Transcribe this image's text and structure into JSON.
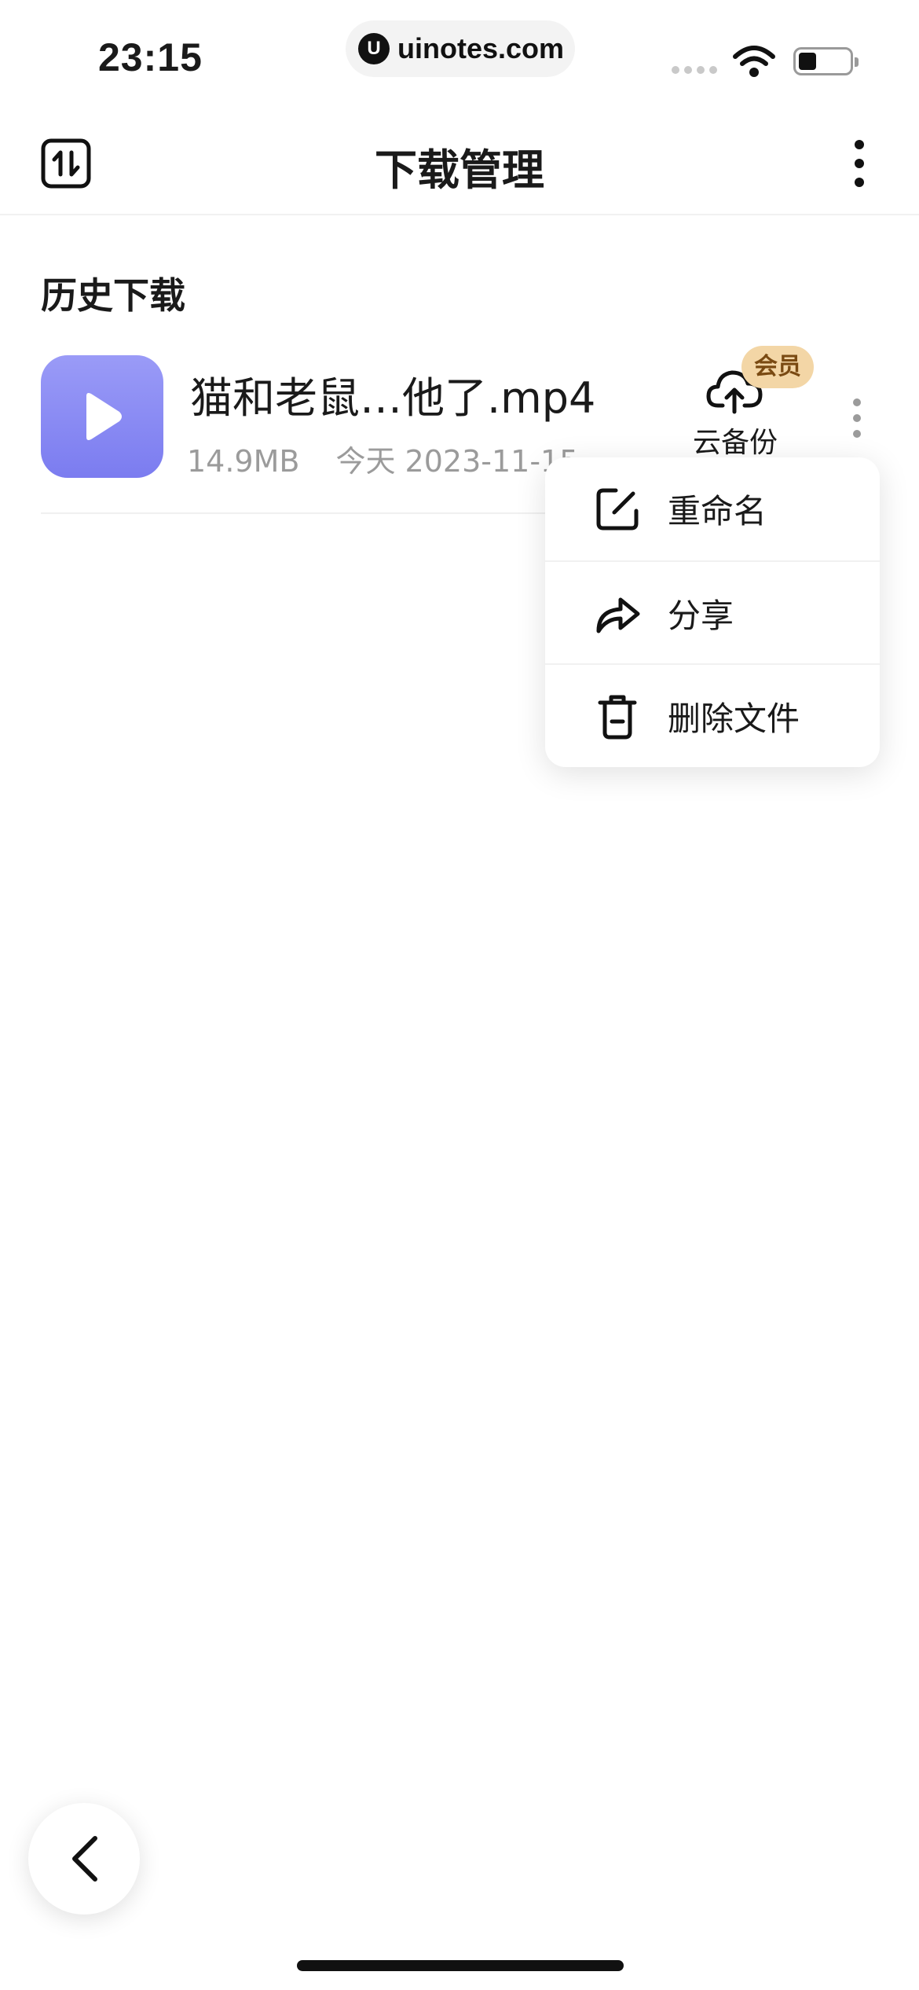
{
  "status_bar": {
    "time": "23:15",
    "url": "uinotes.com",
    "url_logo": "U"
  },
  "header": {
    "title": "下载管理"
  },
  "section": {
    "title": "历史下载"
  },
  "file": {
    "name": "猫和老鼠…他了.mp4",
    "size": "14.9MB",
    "date": "今天 2023-11-15",
    "cloud_label": "云备份",
    "badge": "会员"
  },
  "menu": {
    "items": [
      {
        "label": "重命名",
        "icon": "edit-icon"
      },
      {
        "label": "分享",
        "icon": "share-icon"
      },
      {
        "label": "删除文件",
        "icon": "trash-icon"
      }
    ]
  },
  "colors": {
    "accent": "#8b8cf4",
    "badge_bg": "#f3d6a6",
    "badge_text": "#7a4a12"
  }
}
